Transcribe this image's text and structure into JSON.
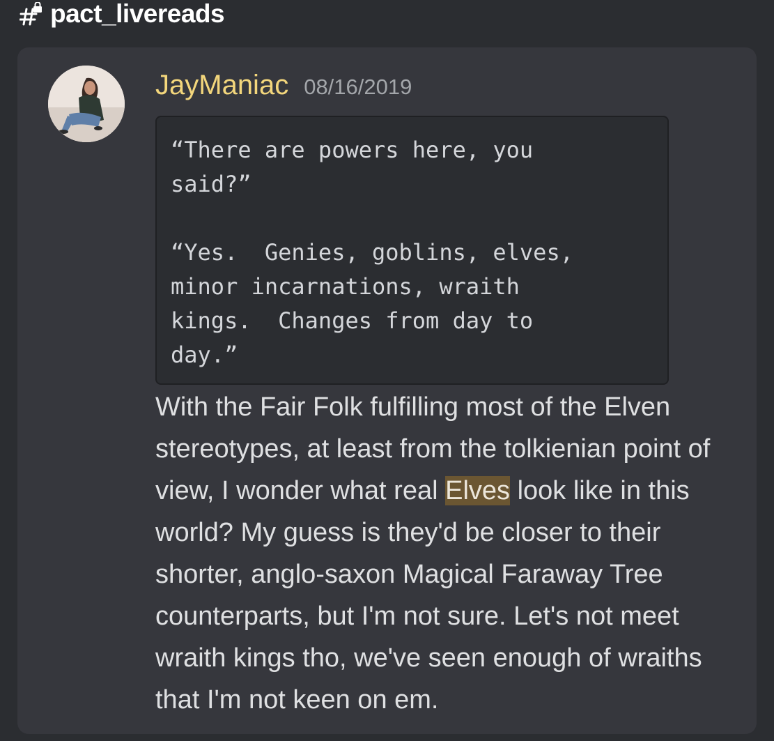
{
  "channel": {
    "icon": "hashtag-lock-icon",
    "name": "pact_livereads"
  },
  "message": {
    "author": "JayManiac",
    "author_color": "#f3d67c",
    "timestamp": "08/16/2019",
    "avatar": "user-avatar-photo",
    "code_block": "“There are powers here, you\nsaid?”\n\n“Yes.  Genies, goblins, elves,\nminor incarnations, wraith\nkings.  Changes from day to\nday.”",
    "body": {
      "before_highlight": "With the Fair Folk fulfilling most of the Elven stereotypes, at least from the tolkienian point of view, I wonder what real ",
      "highlight": "Elves",
      "after_highlight": " look like in this world? My guess is they'd be closer to their shorter, anglo-saxon Magical Faraway Tree counterparts, but I'm not sure. Let's not meet wraith kings tho, we've seen enough of wraiths that I'm not keen on em."
    }
  },
  "colors": {
    "background": "#2b2d31",
    "card": "#36373d",
    "highlight": "#6b5632"
  }
}
